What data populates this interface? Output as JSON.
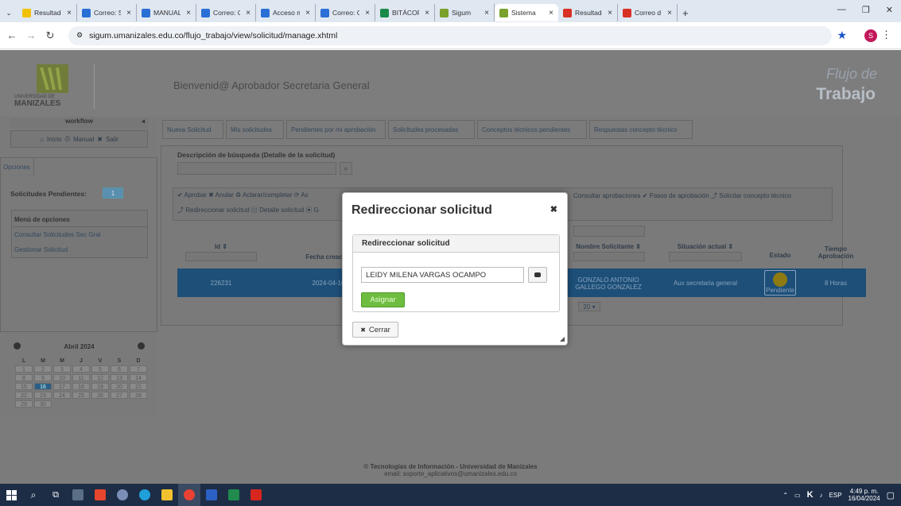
{
  "browser": {
    "tabs": [
      {
        "label": "Resultado",
        "color": "#f2c200"
      },
      {
        "label": "Correo: S",
        "color": "#2a6fd6"
      },
      {
        "label": "MANUAL",
        "color": "#2a6fd6"
      },
      {
        "label": "Correo: C",
        "color": "#2a6fd6"
      },
      {
        "label": "Acceso m",
        "color": "#2a6fd6"
      },
      {
        "label": "Correo: G",
        "color": "#2a6fd6"
      },
      {
        "label": "BITÁCOR",
        "color": "#1a8a4a"
      },
      {
        "label": "Sigum",
        "color": "#7aa12b"
      },
      {
        "label": "Sistema",
        "color": "#7aa12b"
      },
      {
        "label": "Resultado",
        "color": "#d93025"
      },
      {
        "label": "Correo d",
        "color": "#d93025"
      }
    ],
    "url": "sigum.umanizales.edu.co/flujo_trabajo/view/solicitud/manage.xhtml",
    "profile_initial": "S"
  },
  "header": {
    "welcome": "Bienvenid@ Aprobador Secretaria General",
    "brand_line1": "Flujo de",
    "brand_line2": "Trabajo",
    "logo_line1": "UNIVERSIDAD DE",
    "logo_line2": "MANIZALES"
  },
  "sidebar": {
    "workflow_label": "workflow",
    "links": {
      "inicio": "Inicio",
      "manual": "Manual",
      "salir": "Salir"
    },
    "options_tab": "Opciones",
    "pending_label": "Solicitudes Pendientes:",
    "pending_count": "1",
    "menu_title": "Menú de opciones",
    "menu_items": [
      "Consultar Solicitudes Sec Gral",
      "Gestionar Solicitud"
    ],
    "calendar": {
      "month": "Abril 2024",
      "weekdays": [
        "L",
        "M",
        "M",
        "J",
        "V",
        "S",
        "D"
      ],
      "weeks": [
        [
          "1",
          "2",
          "3",
          "4",
          "5",
          "6",
          "7"
        ],
        [
          "8",
          "9",
          "10",
          "11",
          "12",
          "13",
          "14"
        ],
        [
          "15",
          "16",
          "17",
          "18",
          "19",
          "20",
          "21"
        ],
        [
          "22",
          "23",
          "24",
          "25",
          "26",
          "27",
          "28"
        ],
        [
          "29",
          "30",
          "",
          "",
          "",
          "",
          ""
        ]
      ],
      "today": "16"
    }
  },
  "nav_tabs": [
    "Nueva Solicitud",
    "Mis solicitudes",
    "Pendientes por mi aprobación",
    "Solicitudes procesadas",
    "Conceptos técnicos pendientes",
    "Respuestas concepto técnico"
  ],
  "search": {
    "label": "Descripción de búsqueda (Detalle de la solicitud)"
  },
  "actions_line1": "✔ Aprobar  ✖ Anular  ♻ Aclarar/completar  ⟳ As",
  "actions_line1_right": "Consultar aprobaciones  ✔ Pasos de aprobación  ⤴ Solicitar concepto técnico",
  "actions_line2": "⤴ Redireccionar solicitud  ▤ Detalle solicitud  ▣ G",
  "table": {
    "headers": {
      "id": "Id ⇕",
      "fecha": "Fecha creació",
      "nombre": "Nombre Solicitante ⇕",
      "situacion": "Situación actual ⇕",
      "estado": "Estado",
      "tiempo": "Tiempo Aprobación"
    },
    "row": {
      "id": "226231",
      "fecha": "2024-04-16",
      "nombre": "GONZALO ANTONIO GALLEGO GONZALEZ",
      "situacion": "Aux secretaria general",
      "estado": "Pendiente",
      "tiempo": "8 Horas"
    },
    "page_size": "20"
  },
  "modal": {
    "title": "Redireccionar solicitud",
    "panel_title": "Redireccionar solicitud",
    "user_value": "LEIDY MILENA VARGAS OCAMPO",
    "assign_label": "Asignar",
    "close_label": "Cerrar"
  },
  "footer": {
    "line1": "© Tecnologías de Información - Universidad de Manizales",
    "line2": "email: soporte_aplicativos@umanizales.edu.co"
  },
  "taskbar": {
    "lang": "ESP",
    "time": "4:49 p. m.",
    "date": "16/04/2024"
  }
}
